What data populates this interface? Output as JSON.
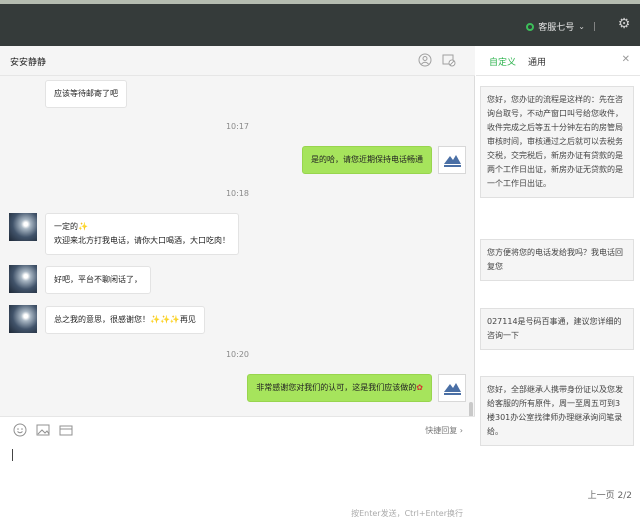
{
  "topbar": {
    "agent_name": "客服七号",
    "divider": "|"
  },
  "chat": {
    "contact_name": "安安静静",
    "messages": [
      {
        "id": "m1",
        "side": "left",
        "text": "应该等待邮寄了吧"
      },
      {
        "id": "t1",
        "side": "time",
        "text": "10:17"
      },
      {
        "id": "m2",
        "side": "right",
        "text": "是的哈，请您近期保持电话畅通"
      },
      {
        "id": "t2",
        "side": "time",
        "text": "10:18"
      },
      {
        "id": "m3",
        "side": "left",
        "line1": "一定的",
        "line2": "欢迎来北方打我电话，请你大口喝酒，大口吃肉！"
      },
      {
        "id": "m4",
        "side": "left",
        "text": "好吧，平台不聊闲话了，"
      },
      {
        "id": "m5",
        "side": "left",
        "text": "总之我的意思，很感谢您！",
        "suffix": "再见"
      },
      {
        "id": "t3",
        "side": "time",
        "text": "10:20"
      },
      {
        "id": "m6",
        "side": "right",
        "text": "非常感谢您对我们的认可，这是我们应该做的"
      }
    ]
  },
  "input": {
    "quick_reply": "快捷回复",
    "hint": "按Enter发送，Ctrl+Enter换行"
  },
  "panel": {
    "tabs": [
      "自定义",
      "通用"
    ],
    "active_tab": "自定义",
    "cards": [
      "您好，您办证的流程是这样的：先在咨询台取号，不动产窗口叫号给您收件，收件完成之后等五十分钟左右的房管局审核时间，审核通过之后就可以去税务交税，交完税后，新房办证有贷款的是两个工作日出证，新房办证无贷款的是一个工作日出证。",
      "您方便将您的电话发给我吗？我电话回复您",
      "027114是号码百事通，建议您详细的咨询一下",
      "您好，全部继承人携带身份证以及您发给客服的所有原件，周一至周五可到3楼301办公室找律师办理继承询问笔录给。"
    ],
    "pager_prev": "上一页",
    "pager_count": "2/2"
  },
  "colors": {
    "topbar": "#353b3a",
    "accent_green": "#2bb24c",
    "bubble_green": "#a6e45c"
  },
  "icons": [
    "status-dot-icon",
    "chevron-down-icon",
    "gear-icon",
    "user-profile-icon",
    "end-chat-icon",
    "emoji-icon",
    "image-icon",
    "folder-icon",
    "chevron-right-icon",
    "close-icon",
    "clap-emoji-icon",
    "rose-emoji-icon"
  ]
}
